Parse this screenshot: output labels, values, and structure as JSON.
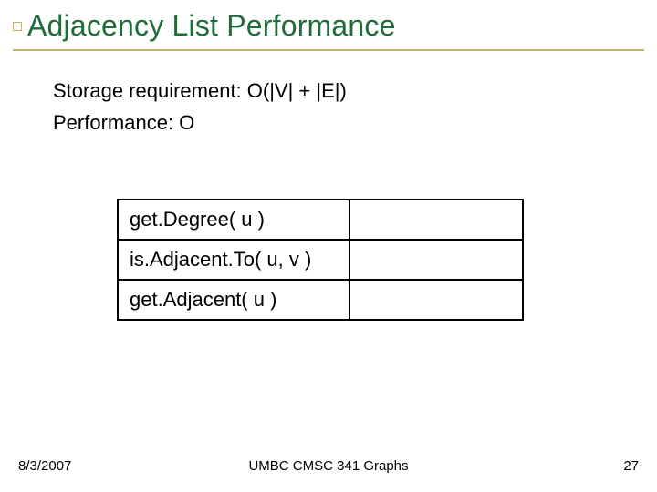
{
  "title": "Adjacency List Performance",
  "lines": {
    "storage": "Storage requirement: O(|V| + |E|)",
    "perf": "Performance: O"
  },
  "table": {
    "rows": [
      {
        "op": "get.Degree( u )",
        "cost": ""
      },
      {
        "op": "is.Adjacent.To( u, v )",
        "cost": ""
      },
      {
        "op": "get.Adjacent( u )",
        "cost": ""
      }
    ]
  },
  "footer": {
    "date": "8/3/2007",
    "center": "UMBC CMSC 341 Graphs",
    "page": "27"
  }
}
